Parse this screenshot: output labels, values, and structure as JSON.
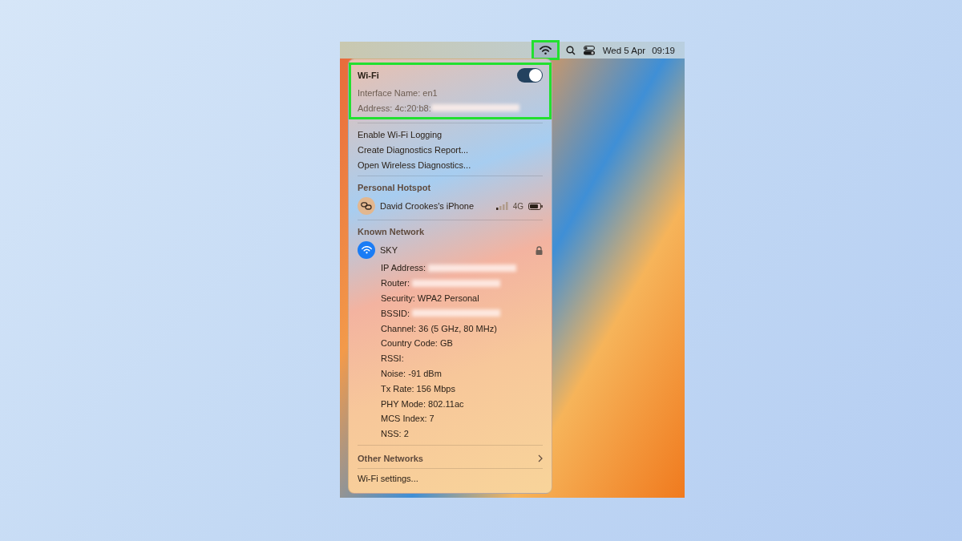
{
  "menubar": {
    "wifi_highlighted": true,
    "date": "Wed 5 Apr",
    "time": "09:19"
  },
  "wifi_header": {
    "title": "Wi-Fi",
    "on": true,
    "highlighted": true,
    "interface": "Interface Name: en1",
    "address": "Address: 4c:20:b8:",
    "address_redacted": true
  },
  "actions": [
    "Enable Wi-Fi Logging",
    "Create Diagnostics Report...",
    "Open Wireless Diagnostics..."
  ],
  "hotspot": {
    "heading": "Personal Hotspot",
    "device": "David Crookes's iPhone",
    "network_type": "4G"
  },
  "known": {
    "heading": "Known Network",
    "network": "SKY",
    "locked": true,
    "details": [
      {
        "text": "IP Address:",
        "redacted": true
      },
      {
        "text": "Router:",
        "redacted": true
      },
      {
        "text": "Security: WPA2 Personal",
        "redacted": false
      },
      {
        "text": "BSSID:",
        "redacted": true
      },
      {
        "text": "Channel: 36 (5 GHz, 80 MHz)",
        "redacted": false
      },
      {
        "text": "Country Code: GB",
        "redacted": false
      },
      {
        "text": "RSSI:",
        "redacted": false
      },
      {
        "text": "Noise: -91 dBm",
        "redacted": false
      },
      {
        "text": "Tx Rate: 156 Mbps",
        "redacted": false
      },
      {
        "text": "PHY Mode: 802.11ac",
        "redacted": false
      },
      {
        "text": "MCS Index: 7",
        "redacted": false
      },
      {
        "text": "NSS: 2",
        "redacted": false
      }
    ]
  },
  "other_networks": "Other Networks",
  "settings": "Wi-Fi settings..."
}
